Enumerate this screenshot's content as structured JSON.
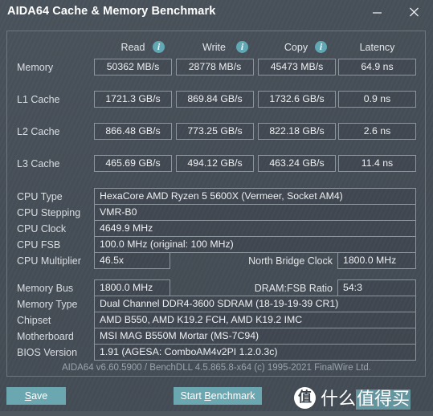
{
  "window": {
    "title": "AIDA64 Cache & Memory Benchmark",
    "minimize_label": "minimize",
    "close_label": "close"
  },
  "benchmark": {
    "columns": [
      "Read",
      "Write",
      "Copy",
      "Latency"
    ],
    "info_icon": "info-icon",
    "rows": [
      {
        "label": "Memory",
        "read": "50362 MB/s",
        "write": "28778 MB/s",
        "copy": "45473 MB/s",
        "latency": "64.9 ns"
      },
      {
        "label": "L1 Cache",
        "read": "1721.3 GB/s",
        "write": "869.84 GB/s",
        "copy": "1732.6 GB/s",
        "latency": "0.9 ns"
      },
      {
        "label": "L2 Cache",
        "read": "866.48 GB/s",
        "write": "773.25 GB/s",
        "copy": "822.18 GB/s",
        "latency": "2.6 ns"
      },
      {
        "label": "L3 Cache",
        "read": "465.69 GB/s",
        "write": "494.12 GB/s",
        "copy": "463.24 GB/s",
        "latency": "11.4 ns"
      }
    ]
  },
  "cpu": {
    "type_label": "CPU Type",
    "type_value": "HexaCore AMD Ryzen 5 5600X  (Vermeer, Socket AM4)",
    "stepping_label": "CPU Stepping",
    "stepping_value": "VMR-B0",
    "clock_label": "CPU Clock",
    "clock_value": "4649.9 MHz",
    "fsb_label": "CPU FSB",
    "fsb_value": "100.0 MHz  (original: 100 MHz)",
    "multiplier_label": "CPU Multiplier",
    "multiplier_value": "46.5x",
    "north_bridge_label": "North Bridge Clock",
    "north_bridge_value": "1800.0 MHz"
  },
  "system": {
    "memory_bus_label": "Memory Bus",
    "memory_bus_value": "1800.0 MHz",
    "dram_fsb_label": "DRAM:FSB Ratio",
    "dram_fsb_value": "54:3",
    "memory_type_label": "Memory Type",
    "memory_type_value": "Dual Channel DDR4-3600 SDRAM  (18-19-19-39 CR1)",
    "chipset_label": "Chipset",
    "chipset_value": "AMD B550, AMD K19.2 FCH, AMD K19.2 IMC",
    "motherboard_label": "Motherboard",
    "motherboard_value": "MSI MAG B550M Mortar (MS-7C94)",
    "bios_label": "BIOS Version",
    "bios_value": "1.91  (AGESA: ComboAM4v2PI 1.2.0.3c)"
  },
  "footer": {
    "credit": "AIDA64 v6.60.5900 / BenchDLL 4.5.865.8-x64  (c) 1995-2021 FinalWire Ltd."
  },
  "actions": {
    "save_accel": "S",
    "save_rest": "ave",
    "bench_pre": "Start ",
    "bench_accel": "B",
    "bench_rest": "enchmark"
  },
  "watermark": {
    "badge": "值",
    "text_plain": "什么",
    "text_highlight": "值得买"
  },
  "colors": {
    "window_bg": "#474f58",
    "accent_teal": "#6ba7b1",
    "info_icon": "#5fa8b4",
    "box_border": "#8d959c",
    "panel_border": "#6d757d",
    "text": "#dfe3e6",
    "muted_text": "#9aa3ab"
  }
}
